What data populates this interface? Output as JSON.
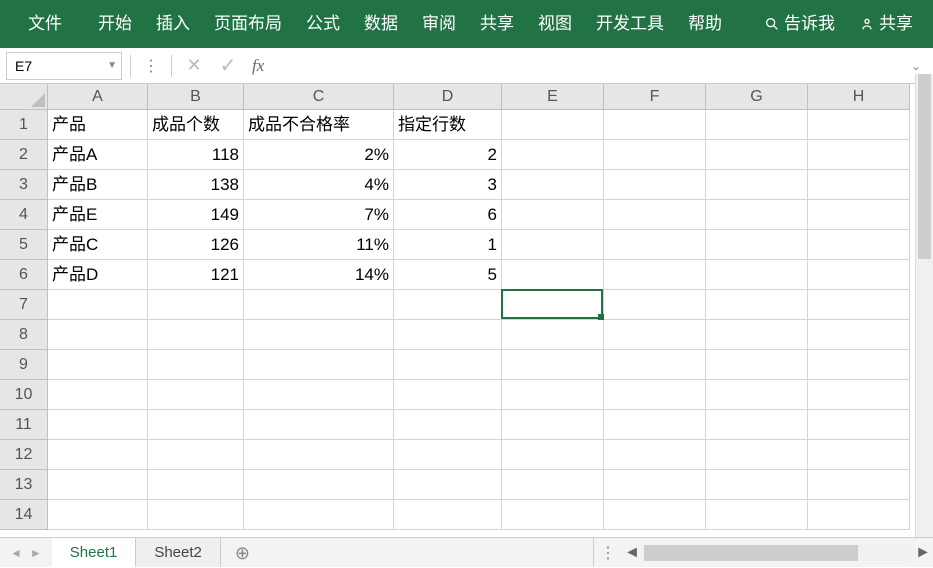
{
  "ribbon": [
    "文件",
    "开始",
    "插入",
    "页面布局",
    "公式",
    "数据",
    "审阅",
    "共享",
    "视图",
    "开发工具",
    "帮助"
  ],
  "ribbon_search": "告诉我",
  "ribbon_share": "共享",
  "name_box": "E7",
  "formula_value": "",
  "fx_label": "fx",
  "columns": [
    "A",
    "B",
    "C",
    "D",
    "E",
    "F",
    "G",
    "H"
  ],
  "row_count": 14,
  "headers": {
    "A": "产品",
    "B": "成品个数",
    "C": "成品不合格率",
    "D": "指定行数"
  },
  "data_rows": [
    {
      "A": "产品A",
      "B": "118",
      "C": "2%",
      "D": "2"
    },
    {
      "A": "产品B",
      "B": "138",
      "C": "4%",
      "D": "3"
    },
    {
      "A": "产品E",
      "B": "149",
      "C": "7%",
      "D": "6"
    },
    {
      "A": "产品C",
      "B": "126",
      "C": "11%",
      "D": "1"
    },
    {
      "A": "产品D",
      "B": "121",
      "C": "14%",
      "D": "5"
    }
  ],
  "sheets": [
    {
      "name": "Sheet1",
      "active": true
    },
    {
      "name": "Sheet2",
      "active": false
    }
  ],
  "active_cell": {
    "col": "E",
    "row": 7
  }
}
